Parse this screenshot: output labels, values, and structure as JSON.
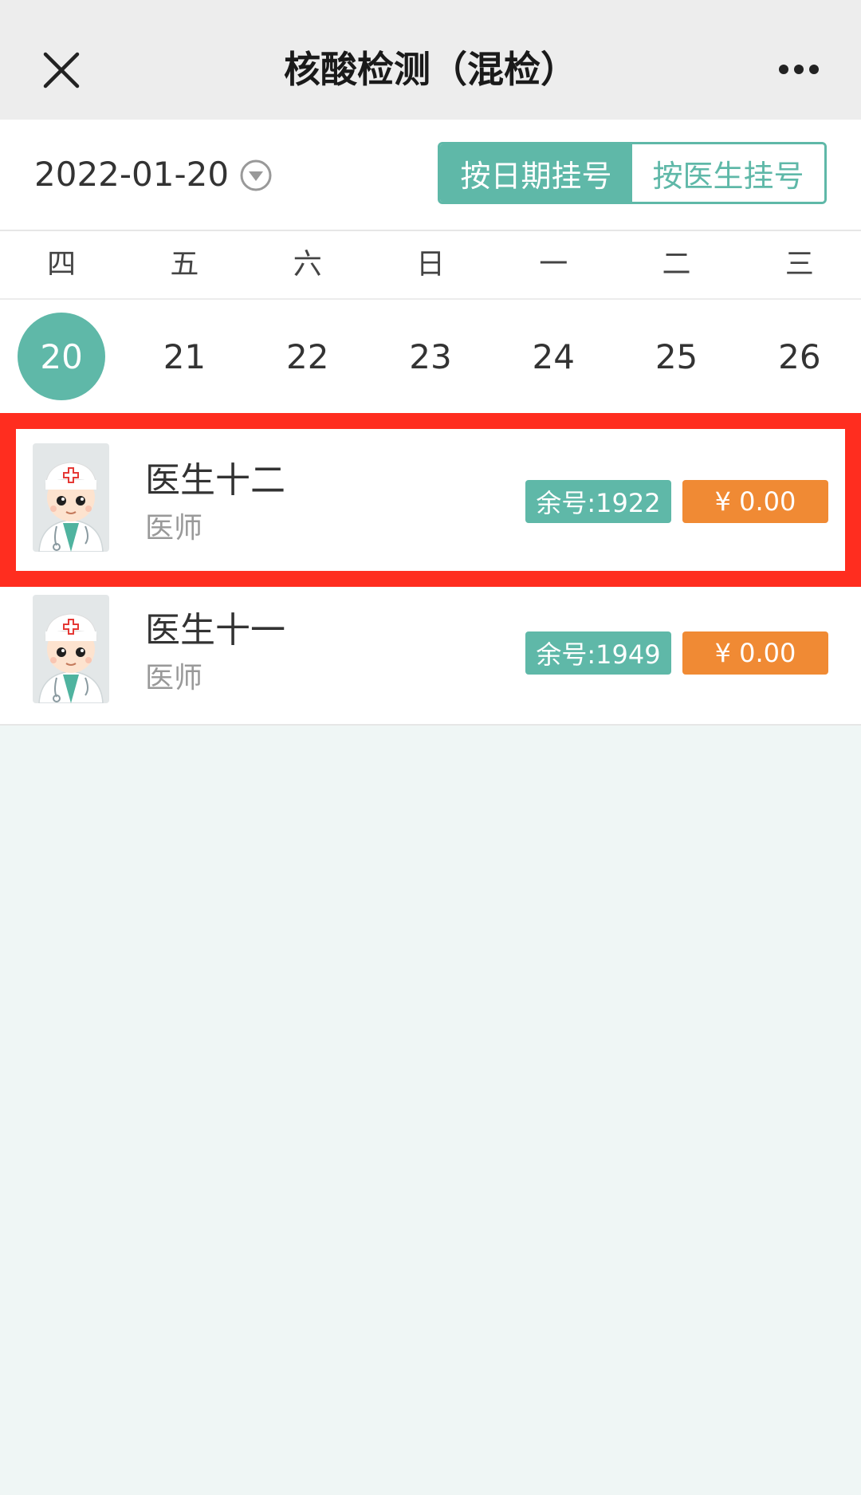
{
  "navbar": {
    "title": "核酸检测（混检）",
    "close_icon": "close-icon",
    "more_icon": "more-dots-icon"
  },
  "date_selector": {
    "date": "2022-01-20",
    "dropdown_icon": "chevron-down-circle-icon",
    "modes": [
      {
        "label": "按日期挂号",
        "active": true
      },
      {
        "label": "按医生挂号",
        "active": false
      }
    ]
  },
  "week": {
    "days": [
      "四",
      "五",
      "六",
      "日",
      "一",
      "二",
      "三"
    ],
    "dates": [
      "20",
      "21",
      "22",
      "23",
      "24",
      "25",
      "26"
    ],
    "selected_index": 0
  },
  "doctors": [
    {
      "name": "医生十二",
      "title": "医师",
      "remaining": "余号:1922",
      "price": "¥ 0.00",
      "highlighted": true
    },
    {
      "name": "医生十一",
      "title": "医师",
      "remaining": "余号:1949",
      "price": "¥ 0.00",
      "highlighted": false
    }
  ],
  "colors": {
    "primary": "#5fb8a8",
    "price": "#f08a34",
    "highlight": "#ff2d1f",
    "background": "#eff6f5"
  }
}
